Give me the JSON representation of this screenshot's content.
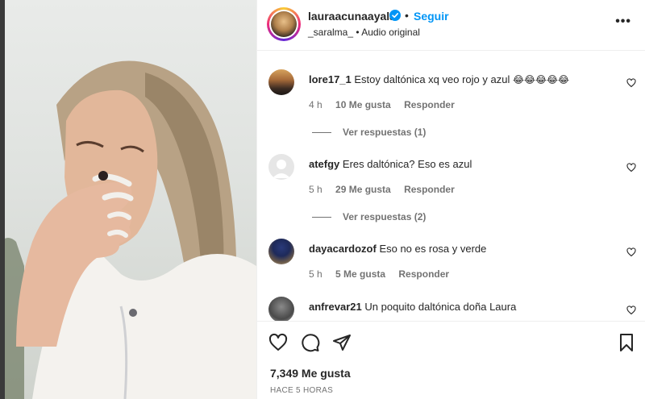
{
  "header": {
    "username": "lauraacunaayala",
    "separator": "•",
    "follow_label": "Seguir",
    "audio_line": "_saralma_ • Audio original",
    "more_label": "•••"
  },
  "comments": [
    {
      "user": "lore17_1",
      "text": "Estoy daltónica xq veo rojo y azul",
      "emojis": "😂😂😂😂😂",
      "time": "4 h",
      "likes": "10 Me gusta",
      "reply": "Responder",
      "view_replies": "Ver respuestas (1)"
    },
    {
      "user": "atefgy",
      "text": "Eres daltónica? Eso es azul",
      "time": "5 h",
      "likes": "29 Me gusta",
      "reply": "Responder",
      "view_replies": "Ver respuestas (2)"
    },
    {
      "user": "dayacardozof",
      "text": "Eso no es rosa y verde",
      "time": "5 h",
      "likes": "5 Me gusta",
      "reply": "Responder"
    },
    {
      "user": "anfrevar21",
      "text": "Un poquito daltónica doña Laura"
    }
  ],
  "footer": {
    "likes": "7,349 Me gusta",
    "posted": "HACE 5 HORAS"
  },
  "icons": {
    "like": "heart-icon",
    "comment": "comment-icon",
    "share": "share-icon",
    "save": "bookmark-icon",
    "verified": "verified-badge-icon"
  },
  "colors": {
    "accent": "#0095f6",
    "text": "#262626",
    "secondary": "#737373"
  }
}
